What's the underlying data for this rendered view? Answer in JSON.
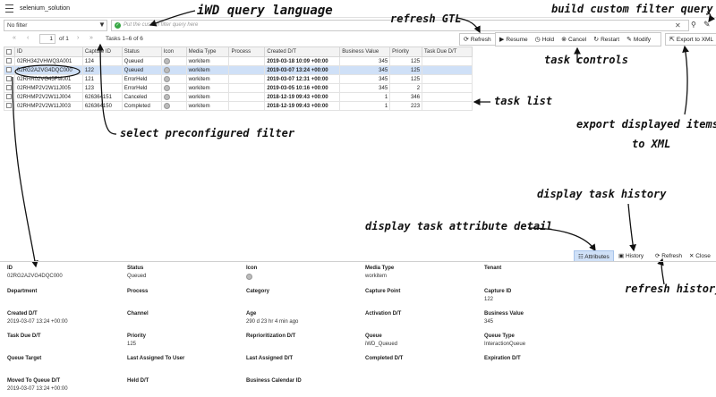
{
  "app": {
    "title": "selenium_solution"
  },
  "filter": {
    "selected": "No filter",
    "placeholder": "Put the custom filter query here"
  },
  "pager": {
    "first": "«",
    "prev": "‹",
    "page": "1",
    "of_label": "of 1",
    "next": "›",
    "last": "»",
    "summary": "Tasks 1–6 of 6"
  },
  "toolbar": {
    "refresh": "Refresh",
    "resume": "Resume",
    "hold": "Hold",
    "cancel": "Cancel",
    "restart": "Restart",
    "modify": "Modify",
    "export": "Export to XML"
  },
  "table": {
    "columns": [
      "ID",
      "Capture ID",
      "Status",
      "Icon",
      "Media Type",
      "Process",
      "Created D/T",
      "Business Value",
      "Priority",
      "Task Due D/T"
    ],
    "rows": [
      {
        "id": "02RH342VHWQ3A001",
        "capture_id": "124",
        "status": "Queued",
        "media": "workitem",
        "process": "",
        "created": "2019-03-18 10:09 +00:00",
        "bv": "345",
        "priority": "125",
        "due": ""
      },
      {
        "id": "02RG2A2VG4DQC000",
        "capture_id": "122",
        "status": "Queued",
        "media": "workitem",
        "process": "",
        "created": "2019-03-07 13:24 +00:00",
        "bv": "345",
        "priority": "125",
        "due": ""
      },
      {
        "id": "02RHR02VG45FM001",
        "capture_id": "121",
        "status": "ErrorHeld",
        "media": "workitem",
        "process": "",
        "created": "2019-03-07 12:31 +00:00",
        "bv": "345",
        "priority": "125",
        "due": ""
      },
      {
        "id": "02RHMP2V2W11J005",
        "capture_id": "123",
        "status": "ErrorHeld",
        "media": "workitem",
        "process": "",
        "created": "2019-03-05 10:16 +00:00",
        "bv": "345",
        "priority": "2",
        "due": ""
      },
      {
        "id": "02RHMP2V2W11J004",
        "capture_id": "626364151",
        "status": "Canceled",
        "media": "workitem",
        "process": "",
        "created": "2018-12-19 09:43 +00:00",
        "bv": "1",
        "priority": "346",
        "due": ""
      },
      {
        "id": "02RHMP2V2W11J003",
        "capture_id": "626364150",
        "status": "Completed",
        "media": "workitem",
        "process": "",
        "created": "2018-12-19 09:43 +00:00",
        "bv": "1",
        "priority": "223",
        "due": ""
      }
    ]
  },
  "detail_toolbar": {
    "attributes": "Attributes",
    "history": "History",
    "refresh": "Refresh",
    "close": "Close"
  },
  "attributes": [
    [
      {
        "label": "ID",
        "value": "02RG2A2VG4DQC000"
      },
      {
        "label": "Status",
        "value": "Queued"
      },
      {
        "label": "Icon",
        "value": ""
      },
      {
        "label": "Media Type",
        "value": "workitem"
      },
      {
        "label": "Tenant",
        "value": ""
      }
    ],
    [
      {
        "label": "Department",
        "value": ""
      },
      {
        "label": "Process",
        "value": ""
      },
      {
        "label": "Category",
        "value": ""
      },
      {
        "label": "Capture Point",
        "value": ""
      },
      {
        "label": "Capture ID",
        "value": "122"
      }
    ],
    [
      {
        "label": "Created D/T",
        "value": "2019-03-07 13:24 +00:00"
      },
      {
        "label": "Channel",
        "value": ""
      },
      {
        "label": "Age",
        "value": "290 d 23 hr 4 min ago"
      },
      {
        "label": "Activation D/T",
        "value": ""
      },
      {
        "label": "Business Value",
        "value": "345"
      }
    ],
    [
      {
        "label": "Task Due D/T",
        "value": ""
      },
      {
        "label": "Priority",
        "value": "125"
      },
      {
        "label": "Reprioritization D/T",
        "value": ""
      },
      {
        "label": "Queue",
        "value": "iWD_Queued"
      },
      {
        "label": "Queue Type",
        "value": "InteractionQueue"
      }
    ],
    [
      {
        "label": "Queue Target",
        "value": ""
      },
      {
        "label": "Last Assigned To User",
        "value": ""
      },
      {
        "label": "Last Assigned D/T",
        "value": ""
      },
      {
        "label": "Completed D/T",
        "value": ""
      },
      {
        "label": "Expiration D/T",
        "value": ""
      }
    ],
    [
      {
        "label": "Moved To Queue D/T",
        "value": "2019-03-07 13:24 +00:00"
      },
      {
        "label": "Held D/T",
        "value": ""
      },
      {
        "label": "Business Calendar ID",
        "value": ""
      },
      {
        "label": "",
        "value": ""
      },
      {
        "label": "",
        "value": ""
      }
    ]
  ],
  "annotations": {
    "query_language": "iWD query language",
    "refresh_gtl": "refresh GTL",
    "build_filter": "build custom filter query",
    "task_controls": "task controls",
    "task_list": "task list",
    "preconfigured_filter": "select preconfigured filter",
    "export_line1": "export displayed items",
    "export_line2": "to XML",
    "task_history": "display task history",
    "attribute_detail": "display task attribute detail",
    "refresh_history": "refresh history"
  },
  "colors": {
    "selection": "#cfe0f7",
    "ok": "#37a745",
    "border": "#c9c9c9"
  }
}
